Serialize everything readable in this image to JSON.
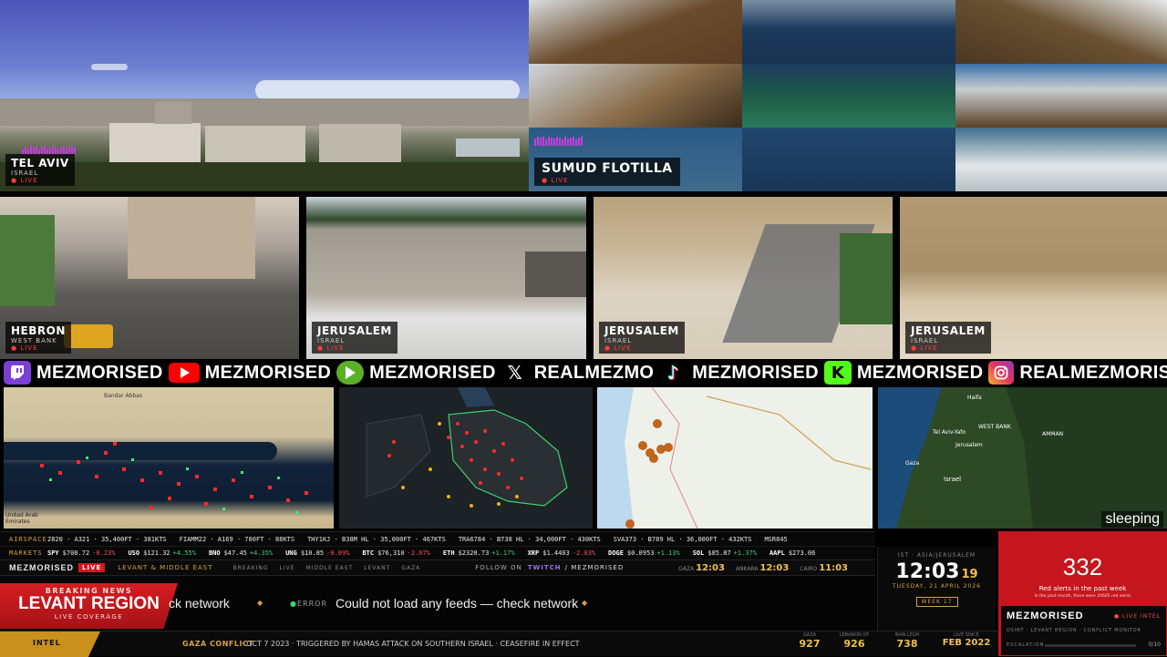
{
  "top_feeds": {
    "tel_aviv": {
      "name": "TEL AVIV",
      "sub": "ISRAEL",
      "live": "● LIVE"
    },
    "flotilla": {
      "name": "SUMUD FLOTILLA",
      "live": "● LIVE"
    }
  },
  "middle_feeds": [
    {
      "name": "HEBRON",
      "sub": "WEST BANK",
      "live": "● LIVE"
    },
    {
      "name": "JERUSALEM",
      "sub": "ISRAEL",
      "live": "● LIVE"
    },
    {
      "name": "JERUSALEM",
      "sub": "ISRAEL",
      "live": "● LIVE"
    },
    {
      "name": "JERUSALEM",
      "sub": "ISRAEL",
      "live": "● LIVE"
    }
  ],
  "social": [
    {
      "platform": "twitch-icon",
      "handle": "MEZMORISED",
      "color": "#7b3fd6"
    },
    {
      "platform": "youtube-icon",
      "handle": "MEZMORISED",
      "color": "#ff0000"
    },
    {
      "platform": "rumble-icon",
      "handle": "MEZMORISED",
      "color": "#5bb026"
    },
    {
      "platform": "x-icon",
      "handle": "REALMEZMO",
      "color": "#000000"
    },
    {
      "platform": "tiktok-icon",
      "handle": "MEZMORISED",
      "color": "#000000"
    },
    {
      "platform": "kick-icon",
      "handle": "MEZMORISED",
      "color": "#53fc18"
    },
    {
      "platform": "instagram-icon",
      "handle": "REALMEZMORISED",
      "color": "#d6249f"
    }
  ],
  "map_labels": {
    "gulf_1": "Bandar Abbas",
    "gulf_2": "United Arab Emirates",
    "israel_1": "Tel Aviv-Yafo",
    "israel_2": "Jerusalem",
    "israel_3": "Gaza",
    "israel_4": "Israel",
    "israel_5": "WEST BANK",
    "israel_6": "AMMAN",
    "israel_7": "Haifa"
  },
  "status_overlay": "sleeping",
  "airspace": {
    "label": "AIRSPACE",
    "items": [
      "2820 · A321 · 35,400FT · 381KTS",
      "FIAMM22 · A169 · 700FT · 88KTS",
      "THY1KJ · B38M HL · 35,000FT · 467KTS",
      "TRA6784 · B738 HL · 34,000FT · 430KTS",
      "SVA373 · B789 HL · 36,000FT · 432KTS",
      "MSR845"
    ]
  },
  "markets": {
    "label": "MARKETS",
    "items": [
      {
        "sym": "SPY",
        "price": "$708.72",
        "chg": "-0.23%",
        "dir": "r"
      },
      {
        "sym": "USO",
        "price": "$121.32",
        "chg": "+4.55%",
        "dir": "g"
      },
      {
        "sym": "BNO",
        "price": "$47.45",
        "chg": "+4.35%",
        "dir": "g"
      },
      {
        "sym": "UNG",
        "price": "$10.85",
        "chg": "-0.09%",
        "dir": "r"
      },
      {
        "sym": "BTC",
        "price": "$76,310",
        "chg": "-2.07%",
        "dir": "r"
      },
      {
        "sym": "ETH",
        "price": "$2320.73",
        "chg": "+1.17%",
        "dir": "g"
      },
      {
        "sym": "XRP",
        "price": "$1.4403",
        "chg": "-2.03%",
        "dir": "r"
      },
      {
        "sym": "DOGE",
        "price": "$0.0953",
        "chg": "+1.13%",
        "dir": "g"
      },
      {
        "sym": "SOL",
        "price": "$85.87",
        "chg": "+1.37%",
        "dir": "g"
      },
      {
        "sym": "AAPL",
        "price": "$273.06",
        "chg": "",
        "dir": "g"
      }
    ]
  },
  "brand_row": {
    "brand": "MEZMORISED",
    "live": "LIVE",
    "region": "LEVANT & MIDDLE EAST",
    "tags": [
      "BREAKING",
      "LIVE",
      "MIDDLE EAST",
      "LEVANT",
      "GAZA"
    ],
    "follow": "FOLLOW ON",
    "follow_platform": "TWITCH",
    "follow_handle": "/ MEZMORISED",
    "clocks": [
      {
        "city": "GAZA",
        "time": "12:03"
      },
      {
        "city": "ANKARA",
        "time": "12:03"
      },
      {
        "city": "CAIRO",
        "time": "11:03"
      }
    ]
  },
  "breaking": {
    "label": "BREAKING NEWS",
    "title": "LEVANT REGION",
    "sub": "LIVE COVERAGE",
    "scroll_left": "ck network",
    "error_tag": "ERROR",
    "error_msg": "Could not load any feeds — check network"
  },
  "clock": {
    "zone": "IST · ASIA/JERUSALEM",
    "hh": "12",
    "mm": "03",
    "ss": "19",
    "date": "TUESDAY, 21 APRIL 2026",
    "week": "WEEK 17"
  },
  "alerts": {
    "count": "332",
    "label": "Red alerts in the past week",
    "sub": "In the past month, there were 20605 red alerts"
  },
  "intel_panel": {
    "brand": "MEZMORISED",
    "live": "● LIVE INTEL",
    "tags": "OSINT · LEVANT REGION · CONFLICT MONITOR",
    "escalation_label": "ESCALATION",
    "escalation_value": "0/10",
    "escalation_level": 0
  },
  "bottom_bar": {
    "intel": "INTEL",
    "conflict": "GAZA CONFLICT",
    "text": "· OCT 7 2023 · TRIGGERED BY HAMAS ATTACK ON SOUTHERN ISRAEL · CEASEFIRE IN EFFECT",
    "stats": [
      {
        "label": "GAZA",
        "value": "927"
      },
      {
        "label": "LEBANON OF",
        "value": "926"
      },
      {
        "label": "IRAN LEGH",
        "value": "738"
      },
      {
        "label": "LIVE SINCE",
        "value": "FEB 2022"
      }
    ]
  }
}
